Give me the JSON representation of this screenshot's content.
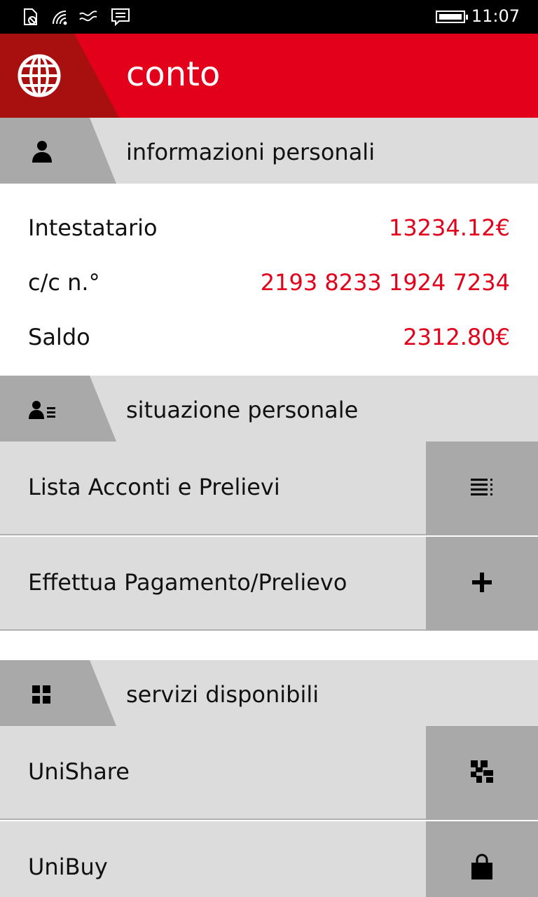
{
  "status_bar": {
    "time": "11:07",
    "icons": [
      "sim-icon",
      "wifi-icon",
      "signal-icon",
      "message-icon",
      "battery-icon"
    ]
  },
  "header": {
    "title": "conto",
    "logo_icon": "globe-icon",
    "accent_color": "#e2001a",
    "accent_dark": "#a80f0f"
  },
  "personal_info": {
    "header_label": "informazioni personali",
    "header_icon": "person-icon",
    "rows": [
      {
        "key": "Intestatario",
        "value": "13234.12€"
      },
      {
        "key": "c/c n.°",
        "value": "2193 8233 1924 7234"
      },
      {
        "key": "Saldo",
        "value": "2312.80€"
      }
    ]
  },
  "personal_situation": {
    "header_label": "situazione personale",
    "header_icon": "person-list-icon",
    "items": [
      {
        "label": "Lista Acconti e Prelievi",
        "icon": "list-icon"
      },
      {
        "label": "Effettua Pagamento/Prelievo",
        "icon": "plus-icon"
      }
    ]
  },
  "services": {
    "header_label": "servizi disponibili",
    "header_icon": "grid-icon",
    "items": [
      {
        "label": "UniShare",
        "icon": "qr-icon"
      },
      {
        "label": "UniBuy",
        "icon": "shopping-bag-icon"
      }
    ]
  }
}
